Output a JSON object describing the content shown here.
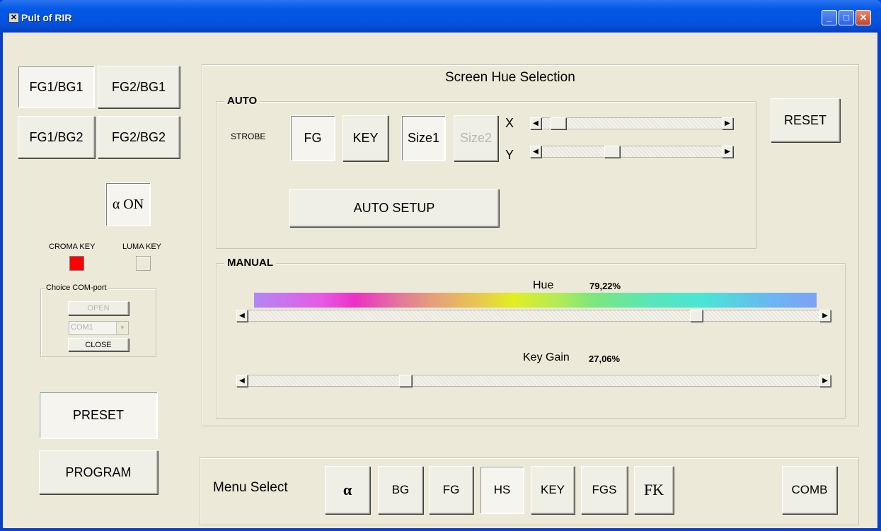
{
  "window": {
    "title": "Pult of RIR",
    "controls": [
      "minimize",
      "maximize",
      "close"
    ]
  },
  "left": {
    "fg_bg_buttons": [
      "FG1/BG1",
      "FG2/BG1",
      "FG1/BG2",
      "FG2/BG2"
    ],
    "alpha_button": "α ON",
    "croma_key_label": "CROMA KEY",
    "luma_key_label": "LUMA KEY",
    "croma_color": "#ff0000",
    "com_group": {
      "title": "Choice COM-port",
      "open": "OPEN",
      "port": "COM1",
      "close": "CLOSE"
    },
    "preset": "PRESET",
    "program": "PROGRAM"
  },
  "screen_hue": {
    "title": "Screen Hue Selection",
    "auto": {
      "legend": "AUTO",
      "strobe": "STROBE",
      "fg": "FG",
      "key": "KEY",
      "size1": "Size1",
      "size2": "Size2",
      "x_label": "X",
      "y_label": "Y",
      "x_value": 0.05,
      "y_value": 0.38,
      "auto_setup": "AUTO SETUP"
    },
    "reset": "RESET",
    "manual": {
      "legend": "MANUAL",
      "hue_label": "Hue",
      "hue_value": "79,22%",
      "hue_fraction": 0.7922,
      "keygain_label": "Key Gain",
      "keygain_value": "27,06%",
      "keygain_fraction": 0.2706
    }
  },
  "menu": {
    "label": "Menu Select",
    "buttons": [
      "α",
      "BG",
      "FG",
      "HS",
      "KEY",
      "FGS",
      "FK"
    ],
    "selected": "HS",
    "comb": "COMB"
  }
}
